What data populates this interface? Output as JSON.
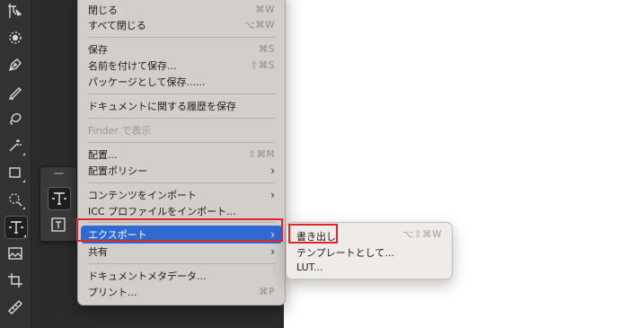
{
  "file_menu": {
    "items": [
      {
        "label": "閉じる",
        "shortcut": "⌘W"
      },
      {
        "label": "すべて閉じる",
        "shortcut": "⌥⌘W"
      },
      {
        "label": "保存",
        "shortcut": "⌘S"
      },
      {
        "label": "名前を付けて保存...",
        "shortcut": "⇧⌘S"
      },
      {
        "label": "パッケージとして保存......",
        "shortcut": ""
      },
      {
        "label": "ドキュメントに関する履歴を保存",
        "shortcut": ""
      },
      {
        "label": "Finder で表示",
        "shortcut": ""
      },
      {
        "label": "配置...",
        "shortcut": "⇧⌘M"
      },
      {
        "label": "配置ポリシー",
        "shortcut": ""
      },
      {
        "label": "コンテンツをインポート",
        "shortcut": ""
      },
      {
        "label": "ICC プロファイルをインポート...",
        "shortcut": ""
      },
      {
        "label": "エクスポート",
        "shortcut": ""
      },
      {
        "label": "共有",
        "shortcut": ""
      },
      {
        "label": "ドキュメントメタデータ...",
        "shortcut": ""
      },
      {
        "label": "プリント...",
        "shortcut": "⌘P"
      }
    ],
    "submenu_arrow": "›"
  },
  "export_submenu": {
    "items": [
      {
        "label": "書き出し",
        "shortcut": "⌥⇧⌘W"
      },
      {
        "label": "テンプレートとして...",
        "shortcut": ""
      },
      {
        "label": "LUT...",
        "shortcut": ""
      }
    ]
  },
  "toolbar": {
    "tools": [
      "artboard-icon",
      "spot-heal-icon",
      "pen-icon",
      "brush-icon",
      "lasso-icon",
      "magic-wand-icon",
      "rectangle-icon",
      "ellipse-select-icon",
      "type-icon",
      "image-icon",
      "crop-icon",
      "ruler-icon"
    ],
    "active_tool": "type-icon"
  },
  "type_flyout": {
    "items": [
      "horizontal-type-icon",
      "type-box-icon"
    ],
    "selected": "horizontal-type-icon"
  },
  "colors": {
    "menu_bg": "#d2cfcb",
    "highlight": "#2f6ad0",
    "submenu_bg": "#eeebe8",
    "annotation": "#e0262b"
  }
}
